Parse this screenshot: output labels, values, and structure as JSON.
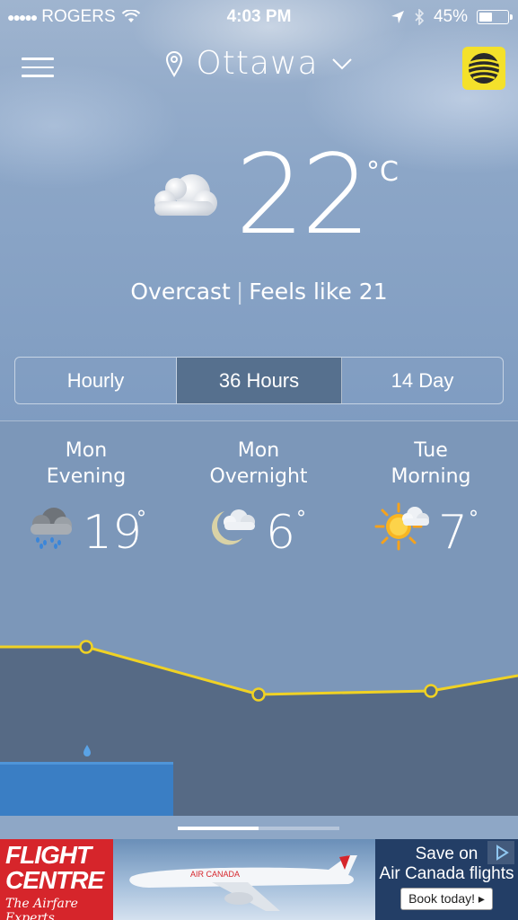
{
  "status_bar": {
    "carrier": "ROGERS",
    "time": "4:03 PM",
    "battery": "45%",
    "battery_level": 0.45,
    "icons": [
      "signal-dots-icon",
      "wifi-icon",
      "location-arrow-icon",
      "bluetooth-icon",
      "battery-icon"
    ]
  },
  "header": {
    "city": "Ottawa",
    "icons": [
      "hamburger-menu-icon",
      "location-pin-icon",
      "chevron-down-icon",
      "weather-channel-logo"
    ]
  },
  "current": {
    "temperature": "22",
    "unit": "°C",
    "condition": "Overcast",
    "separator": "|",
    "feels_like": "Feels like 21",
    "icon": "overcast-cloud-icon"
  },
  "tabs": [
    {
      "label": "Hourly",
      "active": false
    },
    {
      "label": "36 Hours",
      "active": true
    },
    {
      "label": "14 Day",
      "active": false
    }
  ],
  "forecast": [
    {
      "day": "Mon",
      "period": "Evening",
      "temp": "19",
      "icon": "rain-cloud-icon"
    },
    {
      "day": "Mon",
      "period": "Overnight",
      "temp": "6",
      "icon": "moon-cloud-icon"
    },
    {
      "day": "Tue",
      "period": "Morning",
      "temp": "7",
      "icon": "sun-cloud-icon"
    }
  ],
  "degree_symbol": "°",
  "chart": {
    "temp_line_color": "#f0d224",
    "precip_color": "#3a7ec4",
    "precip_icon": "raindrop-icon"
  },
  "pager": {
    "pages": 2,
    "active": 1
  },
  "ad": {
    "brand_line1": "FLIGHT",
    "brand_line2": "CENTRE",
    "tagline": "The Airfare Experts",
    "plane_label": "AIR CANADA",
    "headline1": "Save on",
    "headline2": "Air Canada flights",
    "cta": "Book today! ▸",
    "icons": [
      "ad-choices-icon"
    ]
  }
}
